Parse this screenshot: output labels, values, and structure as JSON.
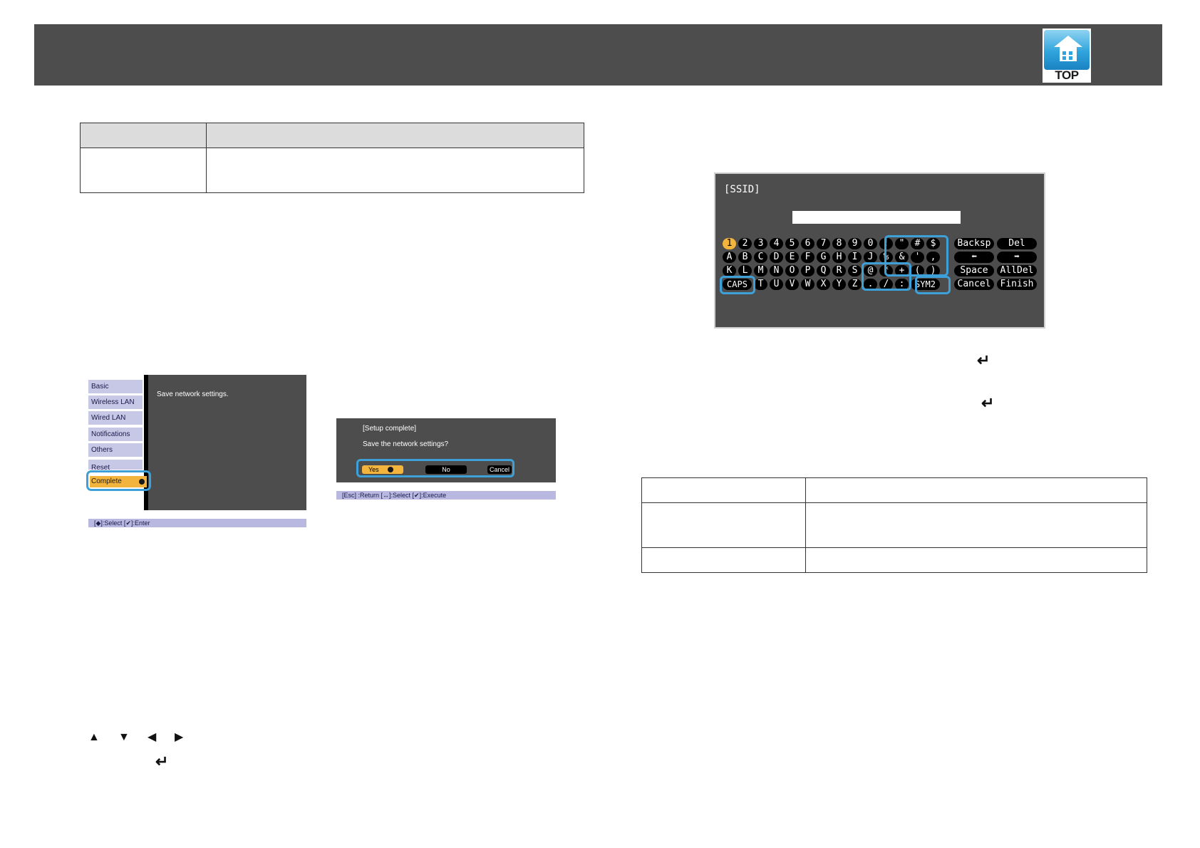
{
  "header": {
    "logo_text": "TOP"
  },
  "save_menu": {
    "items": [
      "Basic",
      "Wireless LAN",
      "Wired LAN",
      "Notifications",
      "Others",
      "Reset",
      "Complete"
    ],
    "message": "Save network settings.",
    "status": "[◆]:Select   [✔]:Enter"
  },
  "confirm_dialog": {
    "title": "[Setup complete]",
    "question": "Save the network settings?",
    "buttons": [
      "Yes",
      "No",
      "Cancel"
    ],
    "status": "[Esc] :Return   [↔]:Select   [✔]:Execute"
  },
  "keyboard": {
    "title": "[SSID]",
    "input_value": "",
    "rows": [
      [
        "1",
        "2",
        "3",
        "4",
        "5",
        "6",
        "7",
        "8",
        "9",
        "0",
        "!",
        "\"",
        "#",
        "$"
      ],
      [
        "A",
        "B",
        "C",
        "D",
        "E",
        "F",
        "G",
        "H",
        "I",
        "J",
        "%",
        "&",
        "'",
        ","
      ],
      [
        "K",
        "L",
        "M",
        "N",
        "O",
        "P",
        "Q",
        "R",
        "S",
        "@",
        "*",
        "+",
        "(",
        ")"
      ],
      [
        "CAPS",
        "T",
        "U",
        "V",
        "W",
        "X",
        "Y",
        "Z",
        ".",
        "/",
        ":",
        "SYM2"
      ]
    ],
    "function_keys": [
      [
        "Backsp",
        "Del"
      ],
      [
        "⬅",
        "➡"
      ],
      [
        "Space",
        "AllDel"
      ],
      [
        "Cancel",
        "Finish"
      ]
    ],
    "selected_key": "1"
  },
  "icons": {
    "enter": "↵",
    "up": "▲",
    "down": "▼",
    "left": "◀",
    "right": "▶"
  }
}
